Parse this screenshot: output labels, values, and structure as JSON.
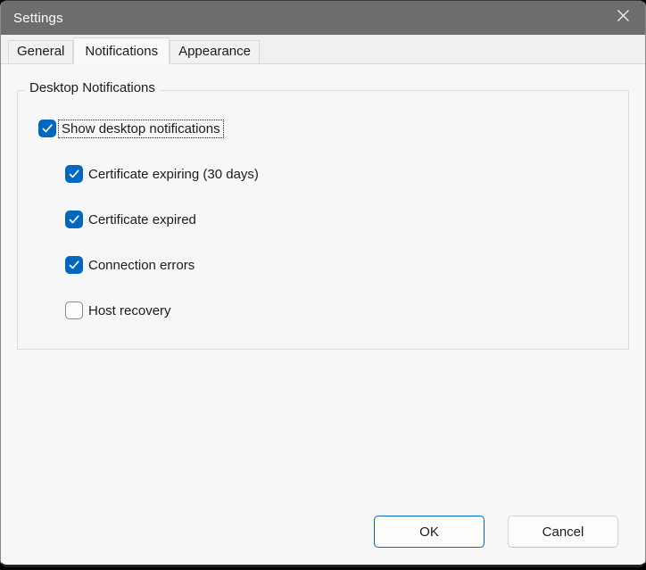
{
  "window": {
    "title": "Settings"
  },
  "tabs": [
    {
      "label": "General",
      "active": false
    },
    {
      "label": "Notifications",
      "active": true
    },
    {
      "label": "Appearance",
      "active": false
    }
  ],
  "group": {
    "title": "Desktop Notifications"
  },
  "checkboxes": [
    {
      "label": "Show desktop notifications",
      "checked": true,
      "focused": true
    },
    {
      "label": "Certificate expiring (30 days)",
      "checked": true,
      "focused": false
    },
    {
      "label": "Certificate expired",
      "checked": true,
      "focused": false
    },
    {
      "label": "Connection errors",
      "checked": true,
      "focused": false
    },
    {
      "label": "Host recovery",
      "checked": false,
      "focused": false
    }
  ],
  "buttons": {
    "ok": "OK",
    "cancel": "Cancel"
  },
  "colors": {
    "accent": "#0067c0",
    "titlebar": "#6d6d6d"
  }
}
